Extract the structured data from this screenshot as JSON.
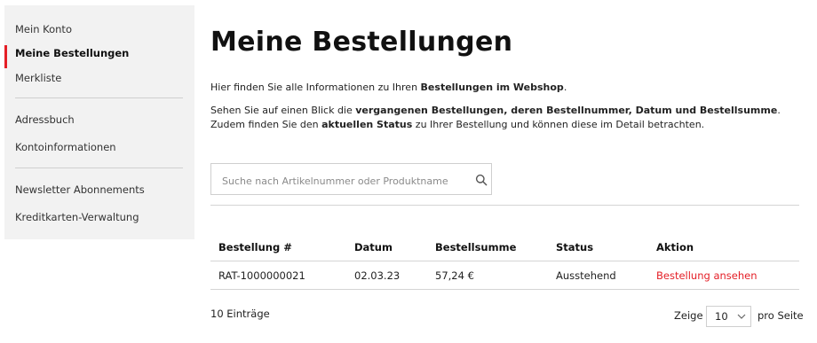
{
  "sidebar": {
    "items": [
      {
        "label": "Mein Konto",
        "active": false
      },
      {
        "label": "Meine Bestellungen",
        "active": true
      },
      {
        "label": "Merkliste",
        "active": false
      },
      {
        "label": "Adressbuch",
        "active": false
      },
      {
        "label": "Kontoinformationen",
        "active": false
      },
      {
        "label": "Newsletter Abonnements",
        "active": false
      },
      {
        "label": "Kreditkarten-Verwaltung",
        "active": false
      }
    ]
  },
  "main": {
    "title": "Meine Bestellungen",
    "intro1": {
      "pre": "Hier finden Sie alle Informationen zu Ihren ",
      "bold": "Bestellungen im Webshop",
      "post": "."
    },
    "intro2": {
      "a": "Sehen Sie auf einen Blick die ",
      "b": "vergangenen Bestellungen, deren Bestellnummer, Datum und Bestellsumme",
      "c": ". Zudem finden Sie den ",
      "d": "aktuellen Status",
      "e": " zu Ihrer Bestellung und können diese im Detail betrachten."
    },
    "search": {
      "placeholder": "Suche nach Artikelnummer oder Produktname",
      "value": "",
      "icon": "search-icon"
    },
    "table": {
      "headers": [
        "Bestellung #",
        "Datum",
        "Bestellsumme",
        "Status",
        "Aktion"
      ],
      "rows": [
        {
          "order": "RAT-1000000021",
          "date": "02.03.23",
          "total": "57,24 €",
          "status": "Ausstehend",
          "action": "Bestellung ansehen"
        }
      ]
    },
    "footer": {
      "entries": "10 Einträge",
      "show_label": "Zeige",
      "per_page": "10",
      "per_page_suffix": "pro Seite"
    }
  },
  "colors": {
    "accent": "#e41e26",
    "sidebar_bg": "#f2f2f2",
    "divider": "#d4d4d4"
  }
}
